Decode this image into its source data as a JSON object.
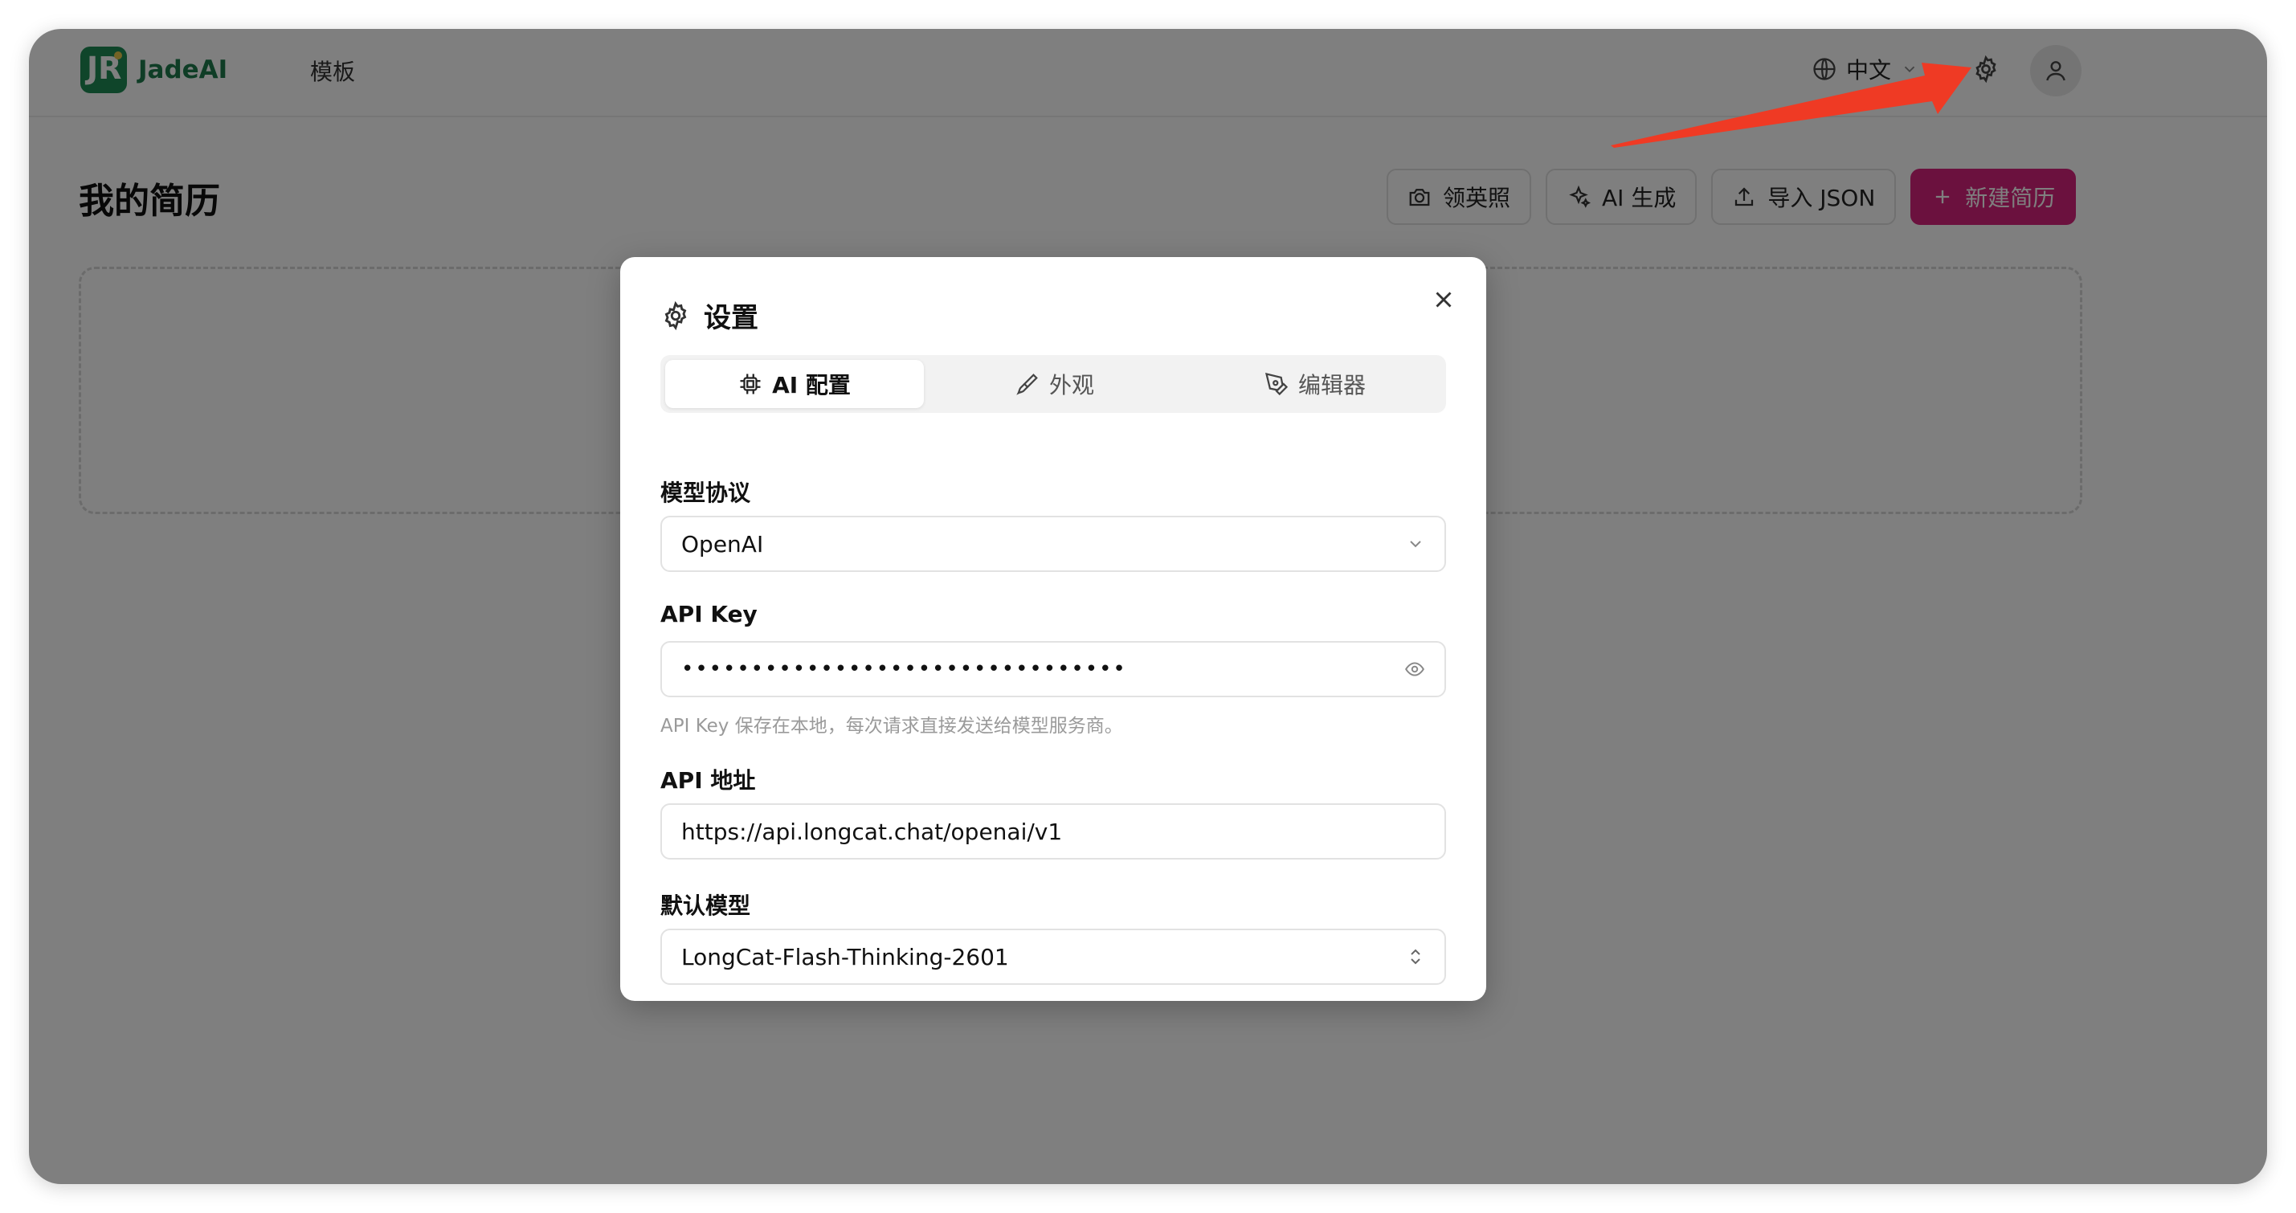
{
  "header": {
    "brand": "JadeAI",
    "logo_letter": "JR",
    "nav_templates": "模板",
    "language": "中文"
  },
  "main": {
    "title": "我的简历",
    "actions": {
      "photo": "领英照",
      "ai_generate": "AI 生成",
      "import_json": "导入 JSON",
      "new_resume": "新建简历"
    }
  },
  "dialog": {
    "title": "设置",
    "tabs": {
      "ai_config": "AI 配置",
      "appearance": "外观",
      "editor": "编辑器"
    },
    "fields": {
      "protocol_label": "模型协议",
      "protocol_value": "OpenAI",
      "api_key_label": "API Key",
      "api_key_value": "••••••••••••••••••••••••••••••••",
      "api_key_hint": "API Key 保存在本地，每次请求直接发送给模型服务商。",
      "api_url_label": "API 地址",
      "api_url_value": "https://api.longcat.chat/openai/v1",
      "model_label": "默认模型",
      "model_value": "LongCat-Flash-Thinking-2601"
    }
  },
  "colors": {
    "brand_green": "#1f8a55",
    "primary_pink": "#d6237d",
    "annotation_arrow": "#ef3a24"
  }
}
